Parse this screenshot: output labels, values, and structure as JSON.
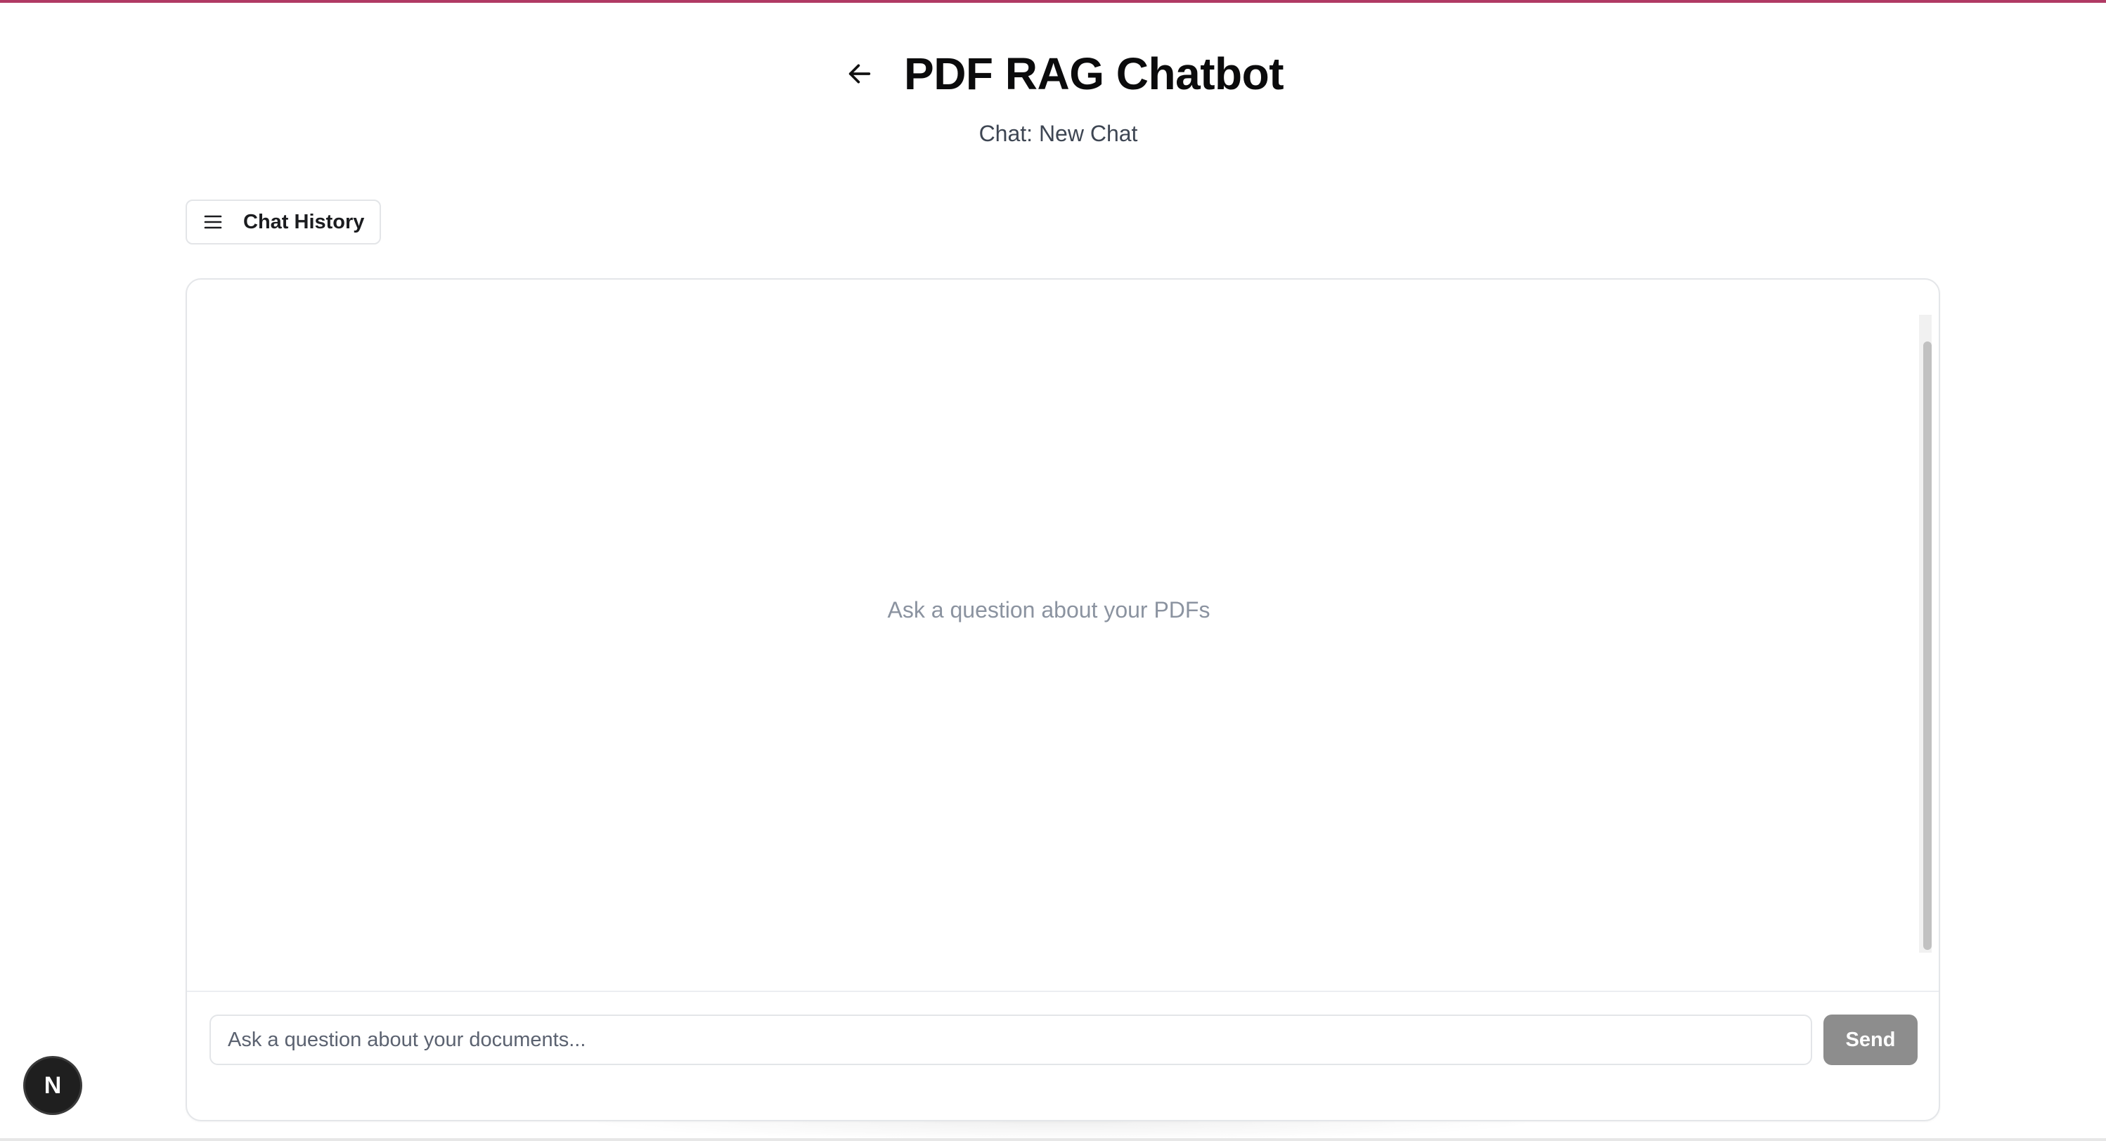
{
  "header": {
    "back_icon": "arrow-left-icon",
    "title": "PDF RAG Chatbot",
    "subtitle": "Chat: New Chat"
  },
  "toolbar": {
    "history_icon": "menu-icon",
    "history_label": "Chat History"
  },
  "chat": {
    "empty_message": "Ask a question about your PDFs"
  },
  "composer": {
    "input_value": "",
    "input_placeholder": "Ask a question about your documents...",
    "send_label": "Send"
  },
  "dev_indicator": {
    "letter": "N",
    "icon": "nextjs-badge-icon"
  },
  "colors": {
    "accent_top_bar": "#b03a64",
    "send_button_disabled": "#8d8d8d",
    "hint_text": "#8b93a0"
  }
}
